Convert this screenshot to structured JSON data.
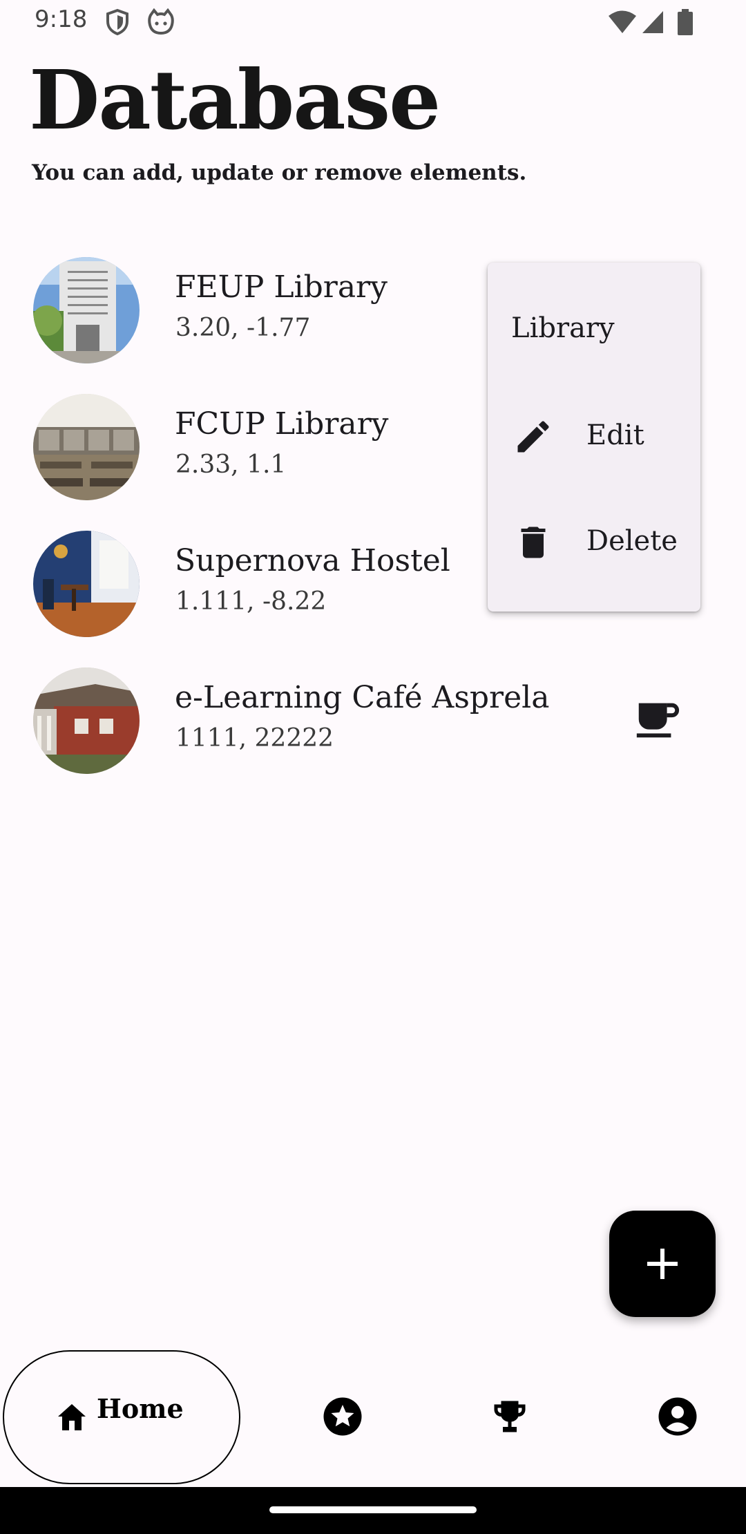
{
  "status_bar": {
    "time": "9:18",
    "icons": [
      "shield-icon",
      "cat-face-icon",
      "wifi-icon",
      "signal-icon",
      "battery-icon"
    ]
  },
  "header": {
    "title": "Database",
    "subtitle": "You can add, update or remove elements."
  },
  "list": {
    "items": [
      {
        "title": "FEUP Library",
        "coords": "3.20, -1.77",
        "image": "library-building-photo"
      },
      {
        "title": "FCUP Library",
        "coords": "2.33, 1.1",
        "image": "reading-room-photo"
      },
      {
        "title": "Supernova Hostel",
        "coords": "1.111, -8.22",
        "image": "hostel-lounge-photo"
      },
      {
        "title": "e-Learning Café Asprela",
        "coords": "1111, 22222",
        "image": "cafe-building-photo",
        "trailing_icon": "coffee-cup-icon"
      }
    ]
  },
  "popup_menu": {
    "header": "Library",
    "items": [
      {
        "label": "Edit",
        "icon": "pencil-icon"
      },
      {
        "label": "Delete",
        "icon": "trash-icon"
      }
    ]
  },
  "fab": {
    "icon": "plus-icon"
  },
  "bottom_nav": {
    "home_label": "Home",
    "items": [
      "home-icon",
      "star-icon",
      "trophy-icon",
      "account-icon"
    ]
  },
  "colors": {
    "background": "#fefafd",
    "menu_background": "#f3eef4",
    "fab": "#000000",
    "text": "#1c1b1f"
  }
}
